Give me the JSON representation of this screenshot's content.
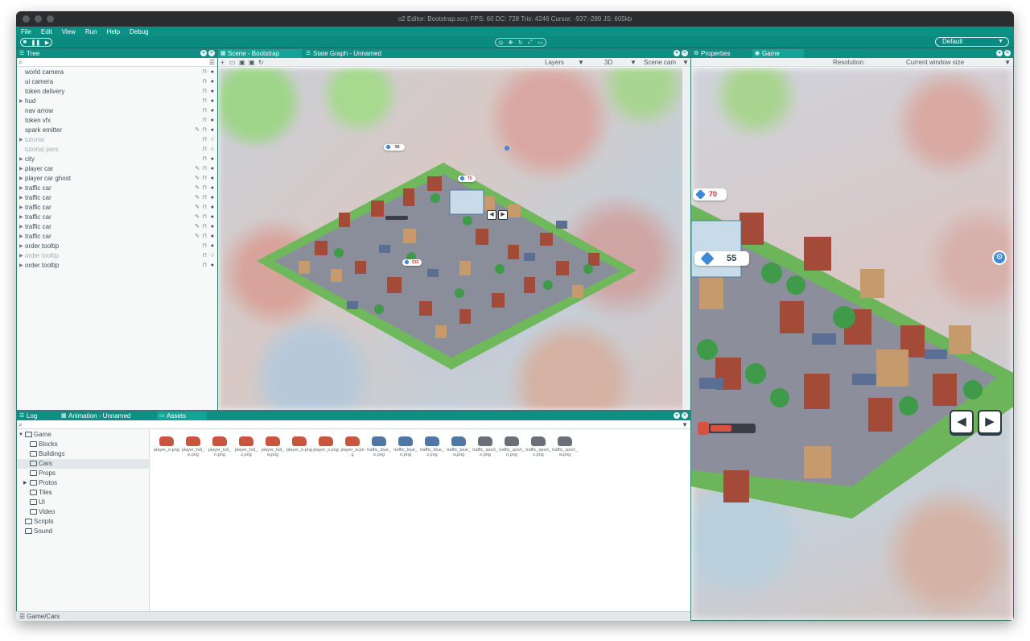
{
  "window": {
    "title": "o2 Editor: Bootstrap.scn; FPS: 60 DC: 728 Tris: 4246 Cursor: -937;-289 JS: 605kb"
  },
  "menu": [
    "File",
    "Edit",
    "View",
    "Run",
    "Help",
    "Debug"
  ],
  "toolbar": {
    "layout": "Default"
  },
  "tree_panel": {
    "tab": "Tree",
    "items": [
      {
        "label": "world camera",
        "dim": false,
        "arrow": false,
        "brush": false
      },
      {
        "label": "ui camera",
        "dim": false,
        "arrow": false,
        "brush": false
      },
      {
        "label": "token delivery",
        "dim": false,
        "arrow": false,
        "brush": false
      },
      {
        "label": "hud",
        "dim": false,
        "arrow": true,
        "brush": false
      },
      {
        "label": "nav arrow",
        "dim": false,
        "arrow": false,
        "brush": false
      },
      {
        "label": "token vfx",
        "dim": false,
        "arrow": false,
        "brush": false
      },
      {
        "label": "spark emitter",
        "dim": false,
        "arrow": false,
        "brush": true
      },
      {
        "label": "tutorial",
        "dim": true,
        "arrow": true,
        "brush": false
      },
      {
        "label": "tutorial pers",
        "dim": true,
        "arrow": false,
        "brush": false
      },
      {
        "label": "city",
        "dim": false,
        "arrow": true,
        "brush": false
      },
      {
        "label": "player car",
        "dim": false,
        "arrow": true,
        "brush": true
      },
      {
        "label": "player car ghost",
        "dim": false,
        "arrow": true,
        "brush": true
      },
      {
        "label": "traffic car",
        "dim": false,
        "arrow": true,
        "brush": true
      },
      {
        "label": "traffic car",
        "dim": false,
        "arrow": true,
        "brush": true
      },
      {
        "label": "traffic car",
        "dim": false,
        "arrow": true,
        "brush": true
      },
      {
        "label": "traffic car",
        "dim": false,
        "arrow": true,
        "brush": true
      },
      {
        "label": "traffic car",
        "dim": false,
        "arrow": true,
        "brush": true
      },
      {
        "label": "traffic car",
        "dim": false,
        "arrow": true,
        "brush": true
      },
      {
        "label": "order tooltip",
        "dim": false,
        "arrow": true,
        "brush": false
      },
      {
        "label": "order tooltip",
        "dim": true,
        "arrow": true,
        "brush": false
      },
      {
        "label": "order tooltip",
        "dim": false,
        "arrow": true,
        "brush": false
      }
    ]
  },
  "scene_panel": {
    "tabs": [
      "Scene - Bootstrap",
      "State Graph - Unnamed"
    ],
    "layers_label": "Layers",
    "mode_label": "3D",
    "camera_label": "Scene cam",
    "badges": {
      "small_55": "55",
      "small_70": "70",
      "small_515": "515"
    }
  },
  "game_panel": {
    "tabs": [
      "Properties",
      "Game"
    ],
    "resolution_label": "Resolution:",
    "resolution_value": "Current window size",
    "badges": {
      "gems_70": "70",
      "gems_55": "55"
    }
  },
  "bottom_panel": {
    "tabs": [
      "Log",
      "Animation - Unnamed",
      "Assets"
    ],
    "folders": [
      {
        "label": "Game",
        "indent": 0,
        "arrow": true,
        "selected": false
      },
      {
        "label": "Blocks",
        "indent": 1,
        "arrow": false,
        "selected": false
      },
      {
        "label": "Buildings",
        "indent": 1,
        "arrow": false,
        "selected": false
      },
      {
        "label": "Cars",
        "indent": 1,
        "arrow": false,
        "selected": true
      },
      {
        "label": "Props",
        "indent": 1,
        "arrow": false,
        "selected": false
      },
      {
        "label": "Protos",
        "indent": 1,
        "arrow": true,
        "selected": false
      },
      {
        "label": "Tiles",
        "indent": 1,
        "arrow": false,
        "selected": false
      },
      {
        "label": "UI",
        "indent": 1,
        "arrow": false,
        "selected": false
      },
      {
        "label": "Video",
        "indent": 1,
        "arrow": false,
        "selected": false
      },
      {
        "label": "Scripts",
        "indent": 0,
        "arrow": false,
        "selected": false
      },
      {
        "label": "Sound",
        "indent": 0,
        "arrow": false,
        "selected": false
      }
    ],
    "assets": [
      {
        "name": "player_e.png",
        "color": "#c8553d"
      },
      {
        "name": "player_full_e.png",
        "color": "#c8553d"
      },
      {
        "name": "player_full_n.png",
        "color": "#c8553d"
      },
      {
        "name": "player_full_s.png",
        "color": "#c8553d"
      },
      {
        "name": "player_full_w.png",
        "color": "#c8553d"
      },
      {
        "name": "player_n.png",
        "color": "#c8553d"
      },
      {
        "name": "player_s.png",
        "color": "#c8553d"
      },
      {
        "name": "player_w.png",
        "color": "#c8553d"
      },
      {
        "name": "traffic_blue_e.png",
        "color": "#4f77a6"
      },
      {
        "name": "traffic_blue_n.png",
        "color": "#4f77a6"
      },
      {
        "name": "traffic_blue_s.png",
        "color": "#4f77a6"
      },
      {
        "name": "traffic_blue_w.png",
        "color": "#4f77a6"
      },
      {
        "name": "traffic_sport_e.png",
        "color": "#6a6f78"
      },
      {
        "name": "traffic_sport_n.png",
        "color": "#6a6f78"
      },
      {
        "name": "traffic_sport_s.png",
        "color": "#6a6f78"
      },
      {
        "name": "traffic_sport_w.png",
        "color": "#6a6f78"
      }
    ]
  },
  "statusbar": {
    "path": "Game/Cars"
  }
}
